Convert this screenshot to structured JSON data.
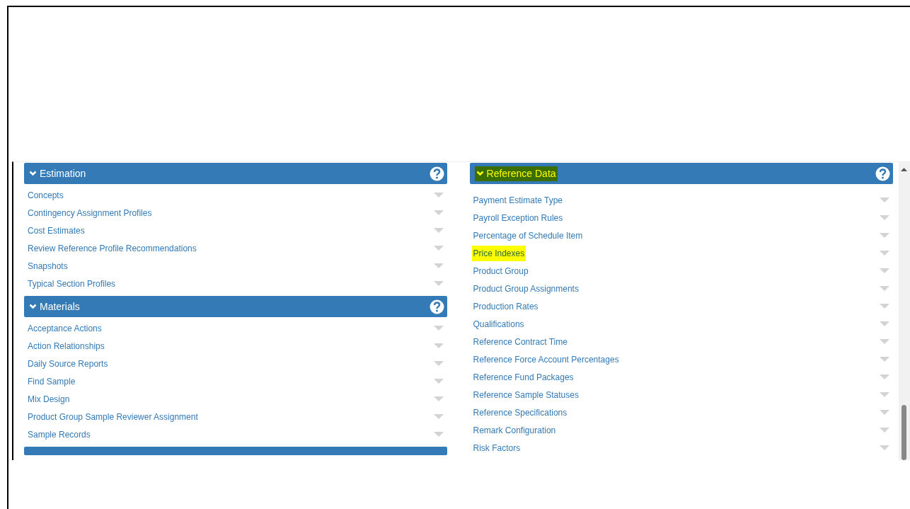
{
  "left_panels": [
    {
      "title": "Estimation",
      "expanded": true,
      "highlighted": false,
      "items": [
        {
          "label": "Concepts",
          "highlighted": false
        },
        {
          "label": "Contingency Assignment Profiles",
          "highlighted": false
        },
        {
          "label": "Cost Estimates",
          "highlighted": false
        },
        {
          "label": "Review Reference Profile Recommendations",
          "highlighted": false
        },
        {
          "label": "Snapshots",
          "highlighted": false
        },
        {
          "label": "Typical Section Profiles",
          "highlighted": false
        }
      ]
    },
    {
      "title": "Materials",
      "expanded": true,
      "highlighted": false,
      "items": [
        {
          "label": "Acceptance Actions",
          "highlighted": false
        },
        {
          "label": "Action Relationships",
          "highlighted": false
        },
        {
          "label": "Daily Source Reports",
          "highlighted": false
        },
        {
          "label": "Find Sample",
          "highlighted": false
        },
        {
          "label": "Mix Design",
          "highlighted": false
        },
        {
          "label": "Product Group Sample Reviewer Assignment",
          "highlighted": false
        },
        {
          "label": "Sample Records",
          "highlighted": false
        }
      ]
    }
  ],
  "right_panel": {
    "title": "Reference Data",
    "expanded": true,
    "highlighted": true,
    "items": [
      {
        "label": "Payment Estimate Type",
        "highlighted": false
      },
      {
        "label": "Payroll Exception Rules",
        "highlighted": false
      },
      {
        "label": "Percentage of Schedule Item",
        "highlighted": false
      },
      {
        "label": "Price Indexes",
        "highlighted": true
      },
      {
        "label": "Product Group",
        "highlighted": false
      },
      {
        "label": "Product Group Assignments",
        "highlighted": false
      },
      {
        "label": "Production Rates",
        "highlighted": false
      },
      {
        "label": "Qualifications",
        "highlighted": false
      },
      {
        "label": "Reference Contract Time",
        "highlighted": false
      },
      {
        "label": "Reference Force Account Percentages",
        "highlighted": false
      },
      {
        "label": "Reference Fund Packages",
        "highlighted": false
      },
      {
        "label": "Reference Sample Statuses",
        "highlighted": false
      },
      {
        "label": "Reference Specifications",
        "highlighted": false
      },
      {
        "label": "Remark Configuration",
        "highlighted": false
      },
      {
        "label": "Risk Factors",
        "highlighted": false
      }
    ]
  }
}
